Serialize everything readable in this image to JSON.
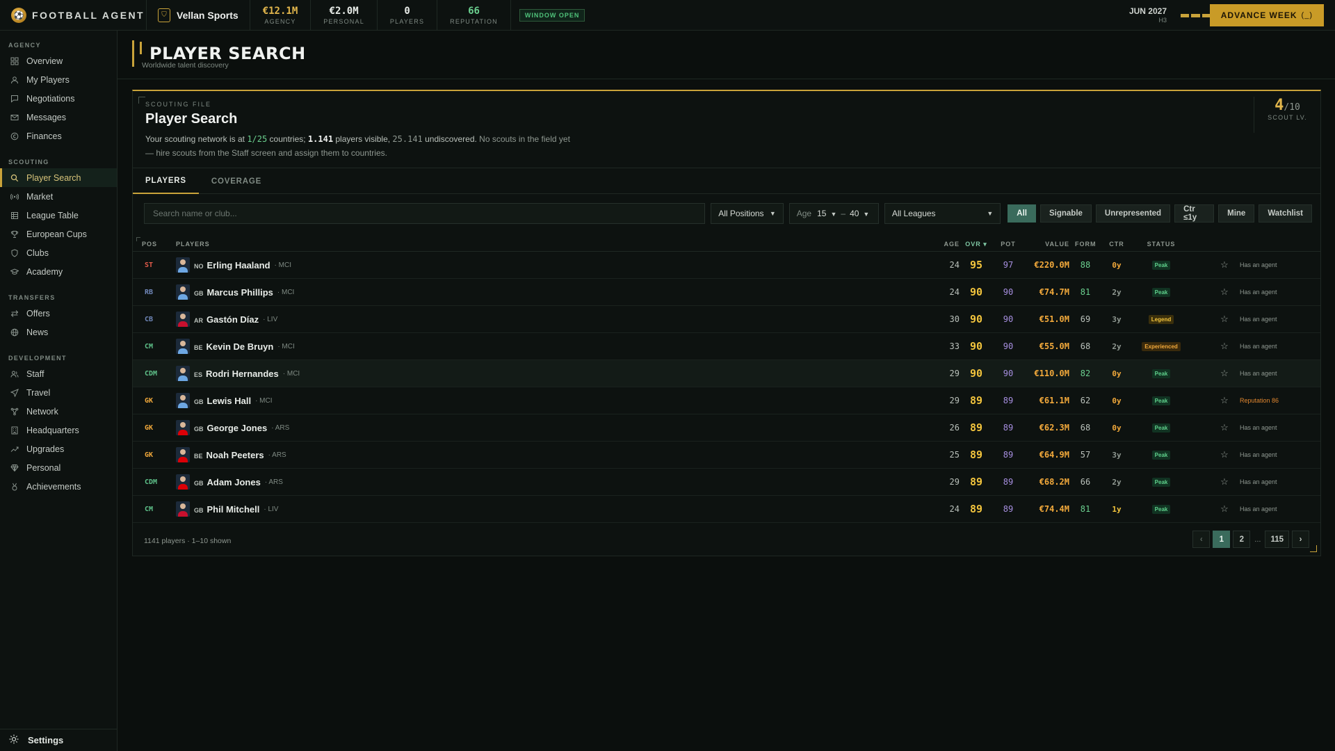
{
  "brand": {
    "name": "FOOTBALL AGENT",
    "logo_icon": "ball-logo-icon"
  },
  "club": {
    "name": "Vellan Sports",
    "badge_icon": "shield-icon"
  },
  "stats": [
    {
      "value": "€12.1M",
      "label": "AGENCY",
      "color": "#e2b64c"
    },
    {
      "value": "€2.0M",
      "label": "PERSONAL",
      "color": "#e8ece8"
    },
    {
      "value": "0",
      "label": "PLAYERS",
      "color": "#e8ece8"
    },
    {
      "value": "66",
      "label": "REPUTATION",
      "color": "#6bd08f"
    }
  ],
  "window_status": "WINDOW OPEN",
  "date": {
    "main": "JUN 2027",
    "sub": "H3",
    "week_progress_segments_on": 3,
    "week_progress_segments_total": 4
  },
  "advance_button": {
    "label": "ADVANCE WEEK",
    "key_hint": "(_)"
  },
  "sidebar": {
    "sections": [
      {
        "title": "AGENCY",
        "items": [
          {
            "label": "Overview",
            "icon": "grid-icon"
          },
          {
            "label": "My Players",
            "icon": "user-icon"
          },
          {
            "label": "Negotiations",
            "icon": "chat-icon"
          },
          {
            "label": "Messages",
            "icon": "mail-icon"
          },
          {
            "label": "Finances",
            "icon": "coin-icon"
          }
        ]
      },
      {
        "title": "SCOUTING",
        "items": [
          {
            "label": "Player Search",
            "icon": "search-icon",
            "active": true
          },
          {
            "label": "Market",
            "icon": "broadcast-icon"
          },
          {
            "label": "League Table",
            "icon": "table-icon"
          },
          {
            "label": "European Cups",
            "icon": "trophy-icon"
          },
          {
            "label": "Clubs",
            "icon": "shield-icon"
          },
          {
            "label": "Academy",
            "icon": "graduation-icon"
          }
        ]
      },
      {
        "title": "TRANSFERS",
        "items": [
          {
            "label": "Offers",
            "icon": "swap-icon"
          },
          {
            "label": "News",
            "icon": "globe-icon"
          }
        ]
      },
      {
        "title": "DEVELOPMENT",
        "items": [
          {
            "label": "Staff",
            "icon": "staff-icon"
          },
          {
            "label": "Travel",
            "icon": "plane-icon"
          },
          {
            "label": "Network",
            "icon": "network-icon"
          },
          {
            "label": "Headquarters",
            "icon": "building-icon"
          },
          {
            "label": "Upgrades",
            "icon": "trend-icon"
          },
          {
            "label": "Personal",
            "icon": "diamond-icon"
          },
          {
            "label": "Achievements",
            "icon": "medal-icon"
          }
        ]
      }
    ],
    "settings_label": "Settings"
  },
  "page": {
    "title": "PLAYER SEARCH",
    "subtitle": "Worldwide talent discovery"
  },
  "scouting_file": {
    "tag": "SCOUTING FILE",
    "title": "Player Search",
    "desc_1": "Your scouting network is at ",
    "countries": "1/25",
    "desc_2": " countries; ",
    "visible": "1.141",
    "desc_3": " players visible, ",
    "undiscovered": "25.141",
    "desc_4": " undiscovered. ",
    "desc_5": "No scouts in the field yet — hire scouts from the Staff screen and assign them to countries.",
    "scout_level": "4",
    "scout_level_max": "/10",
    "scout_level_label": "SCOUT LV."
  },
  "tabs": [
    {
      "label": "PLAYERS",
      "active": true
    },
    {
      "label": "COVERAGE",
      "active": false
    }
  ],
  "filters": {
    "search_placeholder": "Search name or club...",
    "position": "All Positions",
    "age_label": "Age",
    "age_min": "15",
    "age_sep": "–",
    "age_max": "40",
    "league": "All Leagues",
    "chips": [
      {
        "label": "All",
        "active": true
      },
      {
        "label": "Signable",
        "active": false
      },
      {
        "label": "Unrepresented",
        "active": false
      },
      {
        "label": "Ctr ≤1y",
        "active": false
      },
      {
        "label": "Mine",
        "active": false
      },
      {
        "label": "Watchlist",
        "active": false
      }
    ]
  },
  "table": {
    "columns": {
      "pos": "POS",
      "players": "PLAYERS",
      "age": "AGE",
      "ovr": "OVR ▾",
      "pot": "POT",
      "value": "VALUE",
      "form": "FORM",
      "ctr": "CTR",
      "status": "STATUS"
    },
    "rows": [
      {
        "pos": "ST",
        "pos_color": "#e05a4a",
        "nat": "NO",
        "name": "Erling Haaland",
        "club": "· MCI",
        "kit": "#6da7e3",
        "age": "24",
        "ovr": "95",
        "pot": "97",
        "value": "€220.0M",
        "form": "88",
        "form_color": "#6bd08f",
        "ctr": "0y",
        "ctr_color": "#f2a93b",
        "status": "Peak",
        "status_kind": "peak",
        "note": "Has an agent",
        "note_kind": "normal"
      },
      {
        "pos": "RB",
        "pos_color": "#6f86b8",
        "nat": "GB",
        "name": "Marcus Phillips",
        "club": "· MCI",
        "kit": "#6da7e3",
        "age": "24",
        "ovr": "90",
        "pot": "90",
        "value": "€74.7M",
        "form": "81",
        "form_color": "#6bd08f",
        "ctr": "2y",
        "ctr_color": "#8f9891",
        "status": "Peak",
        "status_kind": "peak",
        "note": "Has an agent",
        "note_kind": "normal"
      },
      {
        "pos": "CB",
        "pos_color": "#6f86b8",
        "nat": "AR",
        "name": "Gastón Díaz",
        "club": "· LIV",
        "kit": "#c8102e",
        "age": "30",
        "ovr": "90",
        "pot": "90",
        "value": "€51.0M",
        "form": "69",
        "form_color": "#b9c0ba",
        "ctr": "3y",
        "ctr_color": "#8f9891",
        "status": "Legend",
        "status_kind": "legend",
        "note": "Has an agent",
        "note_kind": "normal"
      },
      {
        "pos": "CM",
        "pos_color": "#5fc28a",
        "nat": "BE",
        "name": "Kevin De Bruyn",
        "club": "· MCI",
        "kit": "#6da7e3",
        "age": "33",
        "ovr": "90",
        "pot": "90",
        "value": "€55.0M",
        "form": "68",
        "form_color": "#b9c0ba",
        "ctr": "2y",
        "ctr_color": "#8f9891",
        "status": "Experienced",
        "status_kind": "exp",
        "note": "Has an agent",
        "note_kind": "normal"
      },
      {
        "pos": "CDM",
        "pos_color": "#5fc28a",
        "nat": "ES",
        "name": "Rodri Hernandes",
        "club": "· MCI",
        "kit": "#6da7e3",
        "age": "29",
        "ovr": "90",
        "pot": "90",
        "value": "€110.0M",
        "form": "82",
        "form_color": "#6bd08f",
        "ctr": "0y",
        "ctr_color": "#f2a93b",
        "status": "Peak",
        "status_kind": "peak",
        "note": "Has an agent",
        "note_kind": "normal",
        "hover": true
      },
      {
        "pos": "GK",
        "pos_color": "#f2a93b",
        "nat": "GB",
        "name": "Lewis Hall",
        "club": "· MCI",
        "kit": "#6da7e3",
        "age": "29",
        "ovr": "89",
        "pot": "89",
        "value": "€61.1M",
        "form": "62",
        "form_color": "#b9c0ba",
        "ctr": "0y",
        "ctr_color": "#f2a93b",
        "status": "Peak",
        "status_kind": "peak",
        "note": "Reputation 86",
        "note_kind": "warn"
      },
      {
        "pos": "GK",
        "pos_color": "#f2a93b",
        "nat": "GB",
        "name": "George Jones",
        "club": "· ARS",
        "kit": "#db0007",
        "age": "26",
        "ovr": "89",
        "pot": "89",
        "value": "€62.3M",
        "form": "68",
        "form_color": "#b9c0ba",
        "ctr": "0y",
        "ctr_color": "#f2a93b",
        "status": "Peak",
        "status_kind": "peak",
        "note": "Has an agent",
        "note_kind": "normal"
      },
      {
        "pos": "GK",
        "pos_color": "#f2a93b",
        "nat": "BE",
        "name": "Noah Peeters",
        "club": "· ARS",
        "kit": "#db0007",
        "age": "25",
        "ovr": "89",
        "pot": "89",
        "value": "€64.9M",
        "form": "57",
        "form_color": "#b9c0ba",
        "ctr": "3y",
        "ctr_color": "#8f9891",
        "status": "Peak",
        "status_kind": "peak",
        "note": "Has an agent",
        "note_kind": "normal"
      },
      {
        "pos": "CDM",
        "pos_color": "#5fc28a",
        "nat": "GB",
        "name": "Adam Jones",
        "club": "· ARS",
        "kit": "#db0007",
        "age": "29",
        "ovr": "89",
        "pot": "89",
        "value": "€68.2M",
        "form": "66",
        "form_color": "#b9c0ba",
        "ctr": "2y",
        "ctr_color": "#8f9891",
        "status": "Peak",
        "status_kind": "peak",
        "note": "Has an agent",
        "note_kind": "normal"
      },
      {
        "pos": "CM",
        "pos_color": "#5fc28a",
        "nat": "GB",
        "name": "Phil Mitchell",
        "club": "· LIV",
        "kit": "#c8102e",
        "age": "24",
        "ovr": "89",
        "pot": "89",
        "value": "€74.4M",
        "form": "81",
        "form_color": "#6bd08f",
        "ctr": "1y",
        "ctr_color": "#f2c43d",
        "status": "Peak",
        "status_kind": "peak",
        "note": "Has an agent",
        "note_kind": "normal"
      }
    ]
  },
  "footer": {
    "count": "1141 players · 1–10 shown"
  },
  "pagination": {
    "prev": "‹",
    "pages": [
      "1",
      "2"
    ],
    "ellipsis": "...",
    "last": "115",
    "next": "›",
    "current": "1"
  }
}
